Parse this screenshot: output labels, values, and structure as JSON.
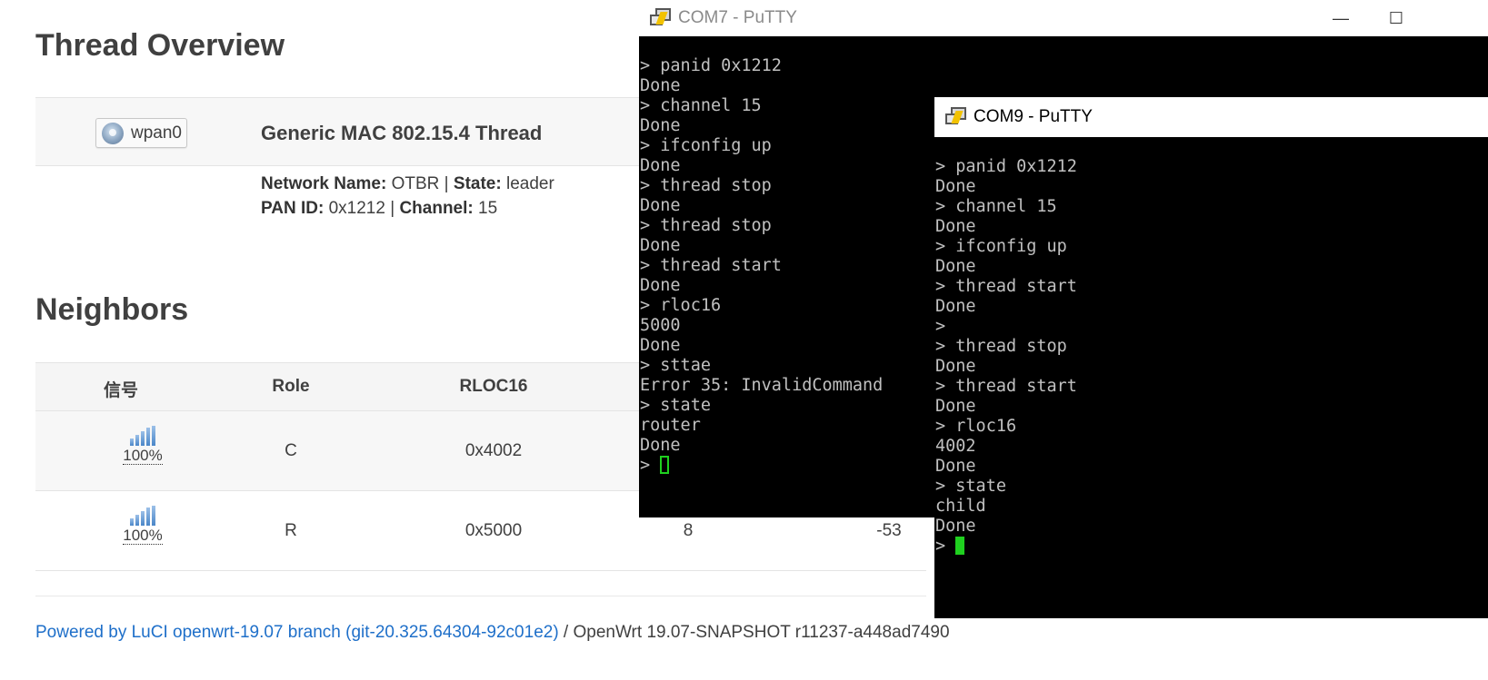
{
  "overview": {
    "title": "Thread Overview",
    "iface_badge": "wpan0",
    "iface_title": "Generic MAC 802.15.4 Thread",
    "network_name_label": "Network Name:",
    "network_name": "OTBR",
    "state_label": "State:",
    "state": "leader",
    "panid_label": "PAN ID:",
    "panid": "0x1212",
    "channel_label": "Channel:",
    "channel": "15",
    "sep": "|"
  },
  "neighbors": {
    "title": "Neighbors",
    "headers": [
      "信号",
      "Role",
      "RLOC16"
    ],
    "rows": [
      {
        "signal": "100%",
        "signal_level": 1.0,
        "role": "C",
        "rloc16": "0x4002",
        "col4": "",
        "col5": ""
      },
      {
        "signal": "100%",
        "signal_level": 1.0,
        "role": "R",
        "rloc16": "0x5000",
        "col4": "8",
        "col5": "-53"
      }
    ]
  },
  "footer": {
    "link": "Powered by LuCI openwrt-19.07 branch (git-20.325.64304-92c01e2)",
    "text": " / OpenWrt 19.07-SNAPSHOT r11237-a448ad7490"
  },
  "com7": {
    "title": "COM7 - PuTTY",
    "minimize": "—",
    "maximize": "☐",
    "lines": [
      "",
      "> panid 0x1212",
      "Done",
      "> channel 15",
      "Done",
      "> ifconfig up",
      "Done",
      "> thread stop",
      "Done",
      "> thread stop",
      "Done",
      "> thread start",
      "Done",
      "> rloc16",
      "5000",
      "Done",
      "> sttae",
      "Error 35: InvalidCommand",
      "> state",
      "router",
      "Done"
    ],
    "prompt": "> "
  },
  "com9": {
    "title": "COM9 - PuTTY",
    "lines": [
      "",
      "> panid 0x1212",
      "Done",
      "> channel 15",
      "Done",
      "> ifconfig up",
      "Done",
      "> thread start",
      "Done",
      ">",
      "> thread stop",
      "Done",
      "> thread start",
      "Done",
      "> rloc16",
      "4002",
      "Done",
      "> state",
      "child",
      "Done"
    ],
    "prompt": "> "
  },
  "colors": {
    "link": "#1e6fc9",
    "terminal_bg": "#000000",
    "terminal_fg": "#c0c0c0",
    "cursor": "#1fd01f"
  }
}
